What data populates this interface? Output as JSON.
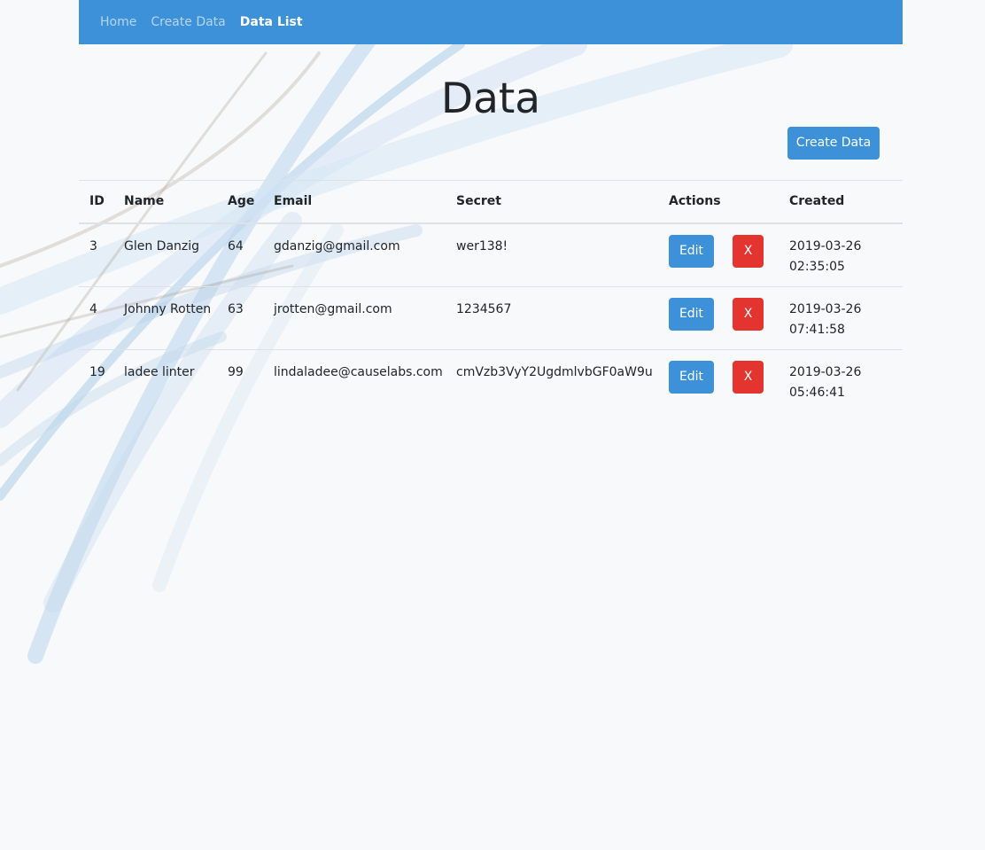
{
  "nav": {
    "items": [
      {
        "label": "Home",
        "active": false
      },
      {
        "label": "Create Data",
        "active": false
      },
      {
        "label": "Data List",
        "active": true
      }
    ]
  },
  "page": {
    "title": "Data",
    "create_button_label": "Create Data"
  },
  "table": {
    "columns": [
      "ID",
      "Name",
      "Age",
      "Email",
      "Secret",
      "Actions",
      "Created"
    ],
    "rows": [
      {
        "id": "3",
        "name": "Glen Danzig",
        "age": "64",
        "email": "gdanzig@gmail.com",
        "secret": "wer138!",
        "edit_label": "Edit",
        "delete_label": "X",
        "created": "2019-03-26\n02:35:05"
      },
      {
        "id": "4",
        "name": "Johnny Rotten",
        "age": "63",
        "email": "jrotten@gmail.com",
        "secret": "1234567",
        "edit_label": "Edit",
        "delete_label": "X",
        "created": "2019-03-26\n07:41:58"
      },
      {
        "id": "19",
        "name": "ladee linter",
        "age": "99",
        "email": "lindaladee@causelabs.com",
        "secret": "cmVzb3VyY2UgdmlvbGF0aW9u",
        "edit_label": "Edit",
        "delete_label": "X",
        "created": "2019-03-26\n05:46:41"
      }
    ]
  },
  "colors": {
    "primary": "#3c91d8",
    "danger": "#e3342f",
    "background": "#f8f9fa"
  }
}
